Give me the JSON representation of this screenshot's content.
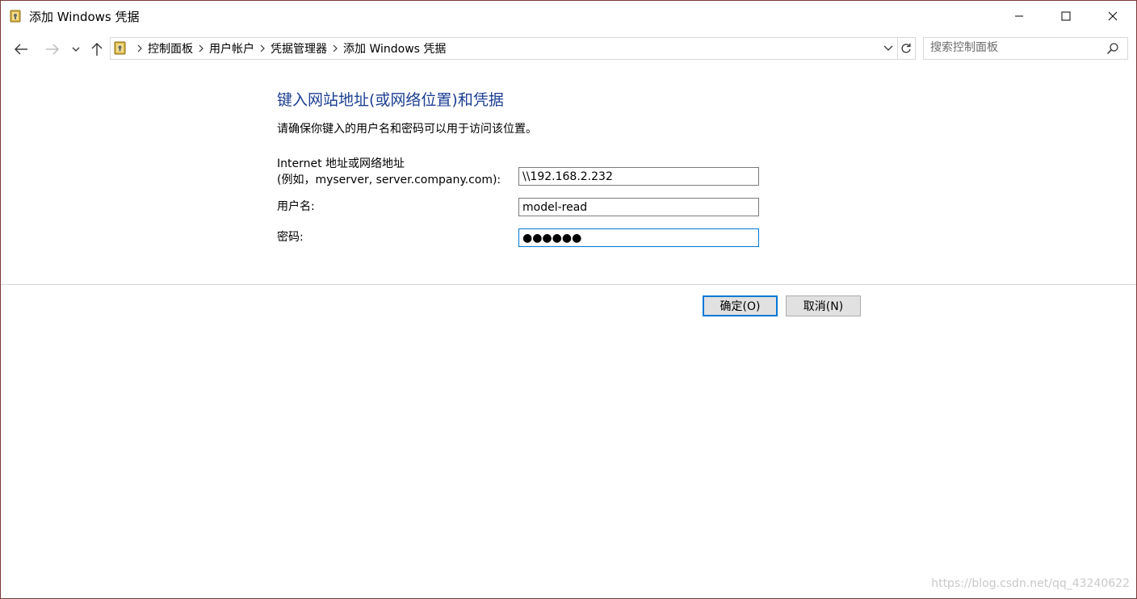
{
  "window": {
    "title": "添加 Windows 凭据"
  },
  "navigation": {
    "breadcrumbs": [
      "控制面板",
      "用户帐户",
      "凭据管理器",
      "添加 Windows 凭据"
    ],
    "search_placeholder": "搜索控制面板"
  },
  "form": {
    "heading": "键入网站地址(或网络位置)和凭据",
    "description": "请确保你键入的用户名和密码可以用于访问该位置。",
    "address_label_line1": "Internet 地址或网络地址",
    "address_label_line2": "(例如，myserver, server.company.com):",
    "address_value": "\\\\192.168.2.232",
    "username_label": "用户名:",
    "username_value": "model-read",
    "password_label": "密码:",
    "password_value": "●●●●●●"
  },
  "buttons": {
    "ok_label": "确定(O)",
    "cancel_label": "取消(N)"
  },
  "watermark": "https://blog.csdn.net/qq_43240622",
  "colors": {
    "heading": "#1c3f94",
    "accent": "#0078d7",
    "window_border": "#7a3b3b"
  },
  "icons": {
    "app": "credential-manager-icon",
    "back": "arrow-left-icon",
    "forward": "arrow-right-icon",
    "recent": "chevron-down-icon",
    "up": "arrow-up-icon",
    "refresh": "refresh-icon",
    "search": "search-icon"
  }
}
